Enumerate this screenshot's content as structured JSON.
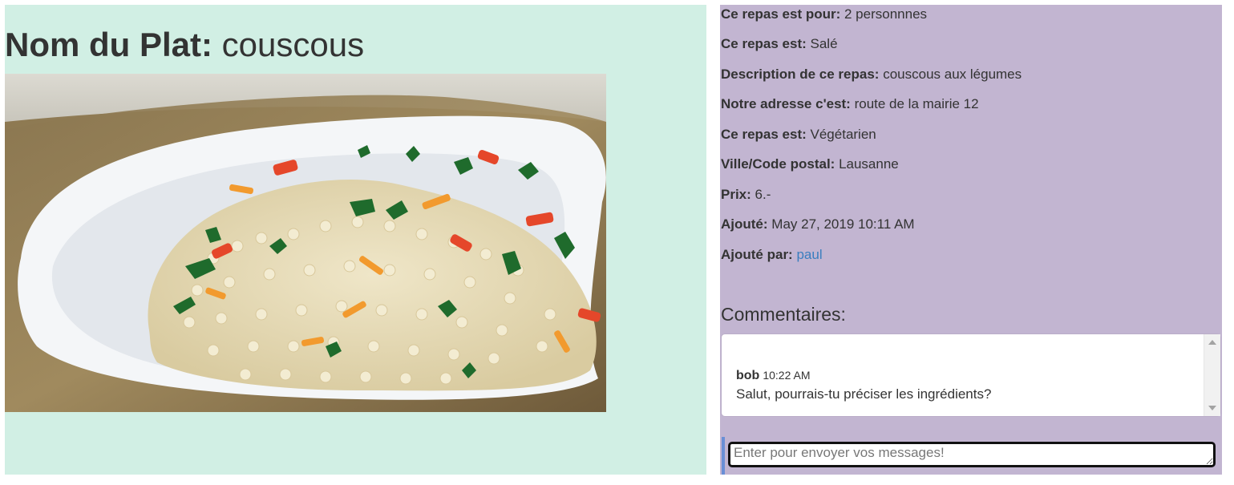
{
  "dish": {
    "title_label": "Nom du Plat:",
    "title_value": "couscous"
  },
  "details": [
    {
      "label": "Ce repas est pour:",
      "value": "2 personnnes"
    },
    {
      "label": "Ce repas est:",
      "value": "Salé"
    },
    {
      "label": "Description de ce repas:",
      "value": "couscous aux légumes"
    },
    {
      "label": "Notre adresse c'est:",
      "value": "route de la mairie 12"
    },
    {
      "label": "Ce repas est:",
      "value": "Végétarien"
    },
    {
      "label": "Ville/Code postal:",
      "value": "Lausanne"
    },
    {
      "label": "Prix:",
      "value": "6.-"
    },
    {
      "label": "Ajouté:",
      "value": "May 27, 2019 10:11 AM"
    },
    {
      "label": "Ajouté par:",
      "value": "paul"
    }
  ],
  "comments": {
    "heading": "Commentaires:",
    "items": [
      {
        "author": "bob",
        "time": "10:22 AM",
        "text": "Salut, pourrais-tu préciser les ingrédients?"
      }
    ]
  },
  "message_input": {
    "placeholder": "Enter pour envoyer vos messages!",
    "value": ""
  },
  "colors": {
    "left_panel_bg": "#d1efe4",
    "right_panel_bg": "#c2b5d1",
    "link": "#3a7ebf",
    "input_accent": "#6a8fd6"
  }
}
